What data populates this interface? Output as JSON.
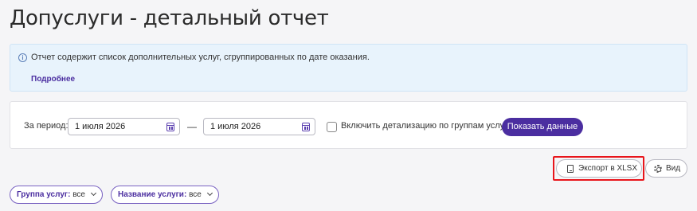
{
  "page": {
    "title": "Допуслуги - детальный отчет"
  },
  "info": {
    "text": "Отчет содержит список дополнительных услуг, сгруппированных по дате оказания.",
    "more_link": "Подробнее",
    "icon": "info-icon"
  },
  "filters": {
    "period_label": "За период:",
    "date_from": "1 июля 2026",
    "date_to": "1 июля 2026",
    "separator": "—",
    "detail_checkbox_label": "Включить детализацию по группам услуг",
    "detail_checked": false,
    "show_button": "Показать данные"
  },
  "toolbar": {
    "export_label": "Экспорт в XLSX",
    "view_label": "Вид"
  },
  "chips": [
    {
      "key": "Группа услуг:",
      "value": "все"
    },
    {
      "key": "Название услуги:",
      "value": "все"
    }
  ],
  "colors": {
    "accent": "#4b2ea0",
    "info_bg": "#e8f3fc",
    "highlight": "#e8151b"
  }
}
